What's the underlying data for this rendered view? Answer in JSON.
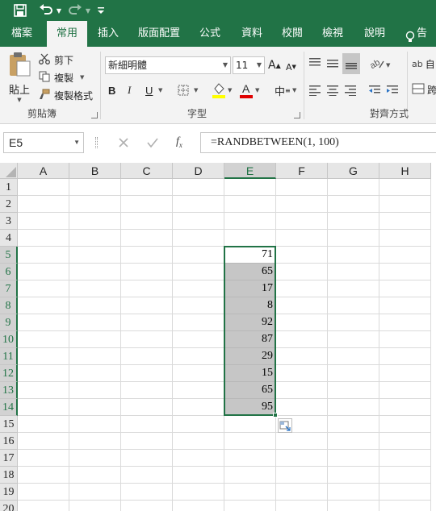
{
  "quick_access": {
    "save_icon": "save-icon",
    "undo_icon": "undo-icon",
    "redo_icon": "redo-icon",
    "customize_icon": "customize-icon"
  },
  "tabs": [
    {
      "label": "檔案"
    },
    {
      "label": "常用"
    },
    {
      "label": "插入"
    },
    {
      "label": "版面配置"
    },
    {
      "label": "公式"
    },
    {
      "label": "資料"
    },
    {
      "label": "校閱"
    },
    {
      "label": "檢視"
    },
    {
      "label": "說明"
    },
    {
      "label": "告訴"
    }
  ],
  "ribbon": {
    "clipboard": {
      "paste_label": "貼上",
      "cut_label": "剪下",
      "copy_label": "複製",
      "format_painter_label": "複製格式",
      "group_label": "剪貼簿"
    },
    "font": {
      "font_name": "新細明體",
      "font_size": "11",
      "bold": "B",
      "italic": "I",
      "underline": "U",
      "group_label": "字型"
    },
    "alignment": {
      "group_label": "對齊方式",
      "wrap_label": "自",
      "merge_label": "跨"
    }
  },
  "formula_bar": {
    "name_box": "E5",
    "formula": "=RANDBETWEEN(1, 100)"
  },
  "sheet": {
    "columns": [
      "A",
      "B",
      "C",
      "D",
      "E",
      "F",
      "G",
      "H"
    ],
    "rows": [
      "1",
      "2",
      "3",
      "4",
      "5",
      "6",
      "7",
      "8",
      "9",
      "10",
      "11",
      "12",
      "13",
      "14",
      "15",
      "16",
      "17",
      "18",
      "19",
      "20"
    ],
    "active_cell": "E5",
    "selection": "E5:E14",
    "values": [
      {
        "row": "5",
        "col": "E",
        "value": "71"
      },
      {
        "row": "6",
        "col": "E",
        "value": "65"
      },
      {
        "row": "7",
        "col": "E",
        "value": "17"
      },
      {
        "row": "8",
        "col": "E",
        "value": "8"
      },
      {
        "row": "9",
        "col": "E",
        "value": "92"
      },
      {
        "row": "10",
        "col": "E",
        "value": "87"
      },
      {
        "row": "11",
        "col": "E",
        "value": "29"
      },
      {
        "row": "12",
        "col": "E",
        "value": "15"
      },
      {
        "row": "13",
        "col": "E",
        "value": "65"
      },
      {
        "row": "14",
        "col": "E",
        "value": "95"
      }
    ]
  },
  "colors": {
    "accent": "#217346",
    "selection_fill": "#c6c6c6"
  }
}
